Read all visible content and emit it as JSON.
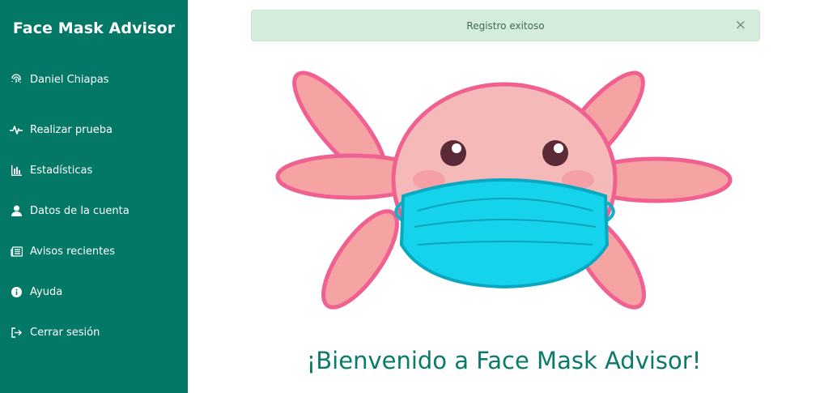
{
  "app": {
    "title": "Face Mask Advisor"
  },
  "sidebar": {
    "user": {
      "name": "Daniel Chiapas",
      "icon": "fingerprint-icon"
    },
    "items": [
      {
        "label": "Realizar prueba",
        "icon": "heartbeat-icon"
      },
      {
        "label": "Estadísticas",
        "icon": "bar-chart-icon"
      },
      {
        "label": "Datos de la cuenta",
        "icon": "user-icon"
      },
      {
        "label": "Avisos recientes",
        "icon": "newspaper-icon"
      },
      {
        "label": "Ayuda",
        "icon": "info-icon"
      },
      {
        "label": "Cerrar sesión",
        "icon": "sign-out-icon"
      }
    ]
  },
  "alert": {
    "message": "Registro exitoso",
    "close": "×"
  },
  "main": {
    "welcome": "¡Bienvenido a Face Mask Advisor!"
  },
  "colors": {
    "sidebar_bg": "#037866",
    "alert_bg": "#d5ecdc",
    "welcome_text": "#0a7a6a",
    "mascot_pink": "#f5a3a3",
    "mascot_outline": "#f06090",
    "mask_blue": "#15d3ea"
  }
}
